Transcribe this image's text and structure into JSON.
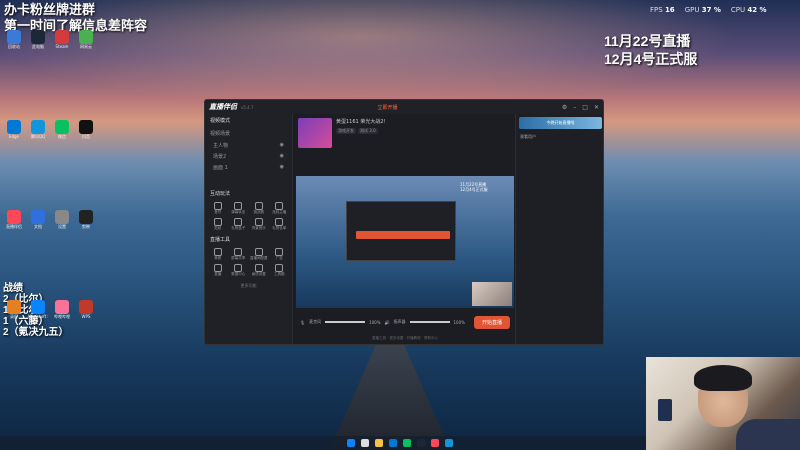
{
  "overlay": {
    "top_left_line1": "办卡粉丝牌进群",
    "top_left_line2": "第一时间了解信息差阵容",
    "top_right_line1": "11月22号直播",
    "top_right_line2": "12月4号正式服",
    "battle_title": "战绩",
    "battle_lines": [
      "2（比尔）",
      "1（比尔）",
      "1（六藤）",
      "2（氪决九五）"
    ]
  },
  "stats": {
    "fps_label": "FPS",
    "fps_value": "16",
    "gpu_label": "GPU",
    "gpu_value": "37 %",
    "cpu_label": "CPU",
    "cpu_value": "42 %"
  },
  "app": {
    "name": "直播伴侣",
    "version": "v5.4.7",
    "live_badge": "立即开播",
    "scene_tab": "视频模式",
    "scene_label": "视频场景",
    "scenes": [
      "主人物",
      "场景2",
      "画面 1"
    ],
    "interaction_title": "互动玩法",
    "interaction_items": [
      "音符",
      "弹幕玩法",
      "挑战赛",
      "连线主播",
      "贴纸",
      "礼物盒子",
      "背景音乐",
      "礼物名单"
    ],
    "tools_title": "直播工具",
    "tools_items": [
      "美颜",
      "屏幕共享",
      "直播间配置",
      "广告",
      "直播",
      "数据中心",
      "画质设置",
      "工具箱"
    ],
    "more_label": "更多功能",
    "stream_title": "黄蛋1161 荣光大战2!",
    "stream_tag1": "游戏开发",
    "stream_tag2": "测试 3.0",
    "start_button": "开始直播",
    "mic_label": "麦克风",
    "mic_value": "100%",
    "speaker_label": "扬声器",
    "speaker_value": "100%",
    "footer_text": "直播工具 · 更多设置 · 开播教程 · 帮助中心",
    "right_banner": "今晚开始直播啦",
    "right_header": "观看用户"
  },
  "desktop_icons": [
    "回收站",
    "此电脑",
    "Steam",
    "网易云",
    "Edge",
    "腾讯QQ",
    "微信",
    "抖音",
    "直播伴侣",
    "文档",
    "设置",
    "剪映",
    "录屏",
    "Microsoft Edge",
    "哔哩哔哩",
    "WPS"
  ],
  "taskbar_icons": [
    "开始",
    "搜索",
    "文件夹",
    "Edge",
    "微信",
    "Steam",
    "直播伴侣",
    "QQ"
  ]
}
